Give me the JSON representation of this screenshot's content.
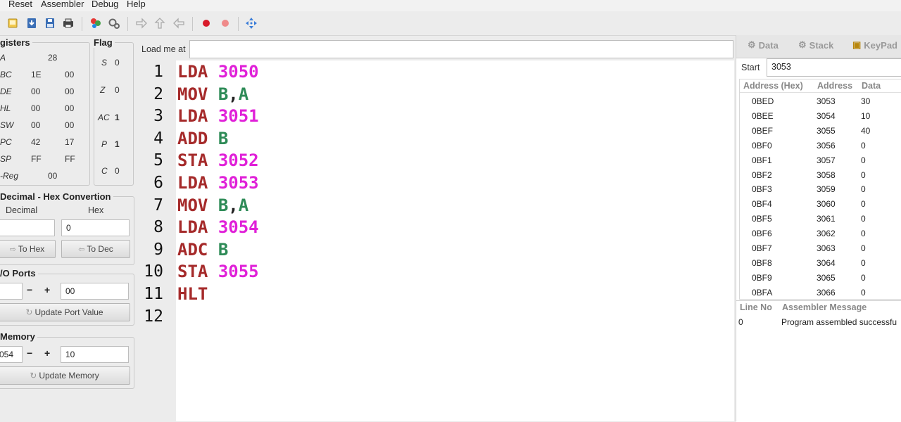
{
  "menu": [
    "Reset",
    "Assembler",
    "Debug",
    "Help"
  ],
  "registers": {
    "title": "gisters",
    "rows": [
      {
        "name": "A",
        "v1": "28",
        "v2": ""
      },
      {
        "name": "BC",
        "v1": "1E",
        "v2": "00"
      },
      {
        "name": "DE",
        "v1": "00",
        "v2": "00"
      },
      {
        "name": "HL",
        "v1": "00",
        "v2": "00"
      },
      {
        "name": "SW",
        "v1": "00",
        "v2": "00"
      },
      {
        "name": "PC",
        "v1": "42",
        "v2": "17"
      },
      {
        "name": "SP",
        "v1": "FF",
        "v2": "FF"
      },
      {
        "name": "-Reg",
        "v1": "00",
        "v2": ""
      }
    ]
  },
  "flags": {
    "title": "Flag",
    "items": [
      {
        "name": "S",
        "value": "0"
      },
      {
        "name": "Z",
        "value": "0"
      },
      {
        "name": "AC",
        "value": "1"
      },
      {
        "name": "P",
        "value": "1"
      },
      {
        "name": "C",
        "value": "0"
      }
    ]
  },
  "conversion": {
    "title": "Decimal - Hex Convertion",
    "decimal_label": "Decimal",
    "hex_label": "Hex",
    "decimal_value": "",
    "hex_value": "0",
    "to_hex": "To Hex",
    "to_dec": "To Dec"
  },
  "io_ports": {
    "title": "/O Ports",
    "port": "",
    "minus": "−",
    "plus": "+",
    "value": "00",
    "update_label": "Update Port Value"
  },
  "memory": {
    "title": "Memory",
    "address": "054",
    "minus": "−",
    "plus": "+",
    "value": "10",
    "update_label": "Update Memory"
  },
  "editor": {
    "load_label": "Load me at",
    "load_value": "",
    "lines": [
      {
        "no": "1",
        "op": "LDA",
        "arg1": "3050",
        "sep": "",
        "arg2": "",
        "argtype": "num"
      },
      {
        "no": "2",
        "op": "MOV",
        "arg1": "B",
        "sep": ",",
        "arg2": "A",
        "argtype": "reg"
      },
      {
        "no": "3",
        "op": "LDA",
        "arg1": "3051",
        "sep": "",
        "arg2": "",
        "argtype": "num"
      },
      {
        "no": "4",
        "op": "ADD",
        "arg1": "B",
        "sep": "",
        "arg2": "",
        "argtype": "reg"
      },
      {
        "no": "5",
        "op": "STA",
        "arg1": "3052",
        "sep": "",
        "arg2": "",
        "argtype": "num"
      },
      {
        "no": "6",
        "op": "LDA",
        "arg1": "3053",
        "sep": "",
        "arg2": "",
        "argtype": "num"
      },
      {
        "no": "7",
        "op": "MOV",
        "arg1": "B",
        "sep": ",",
        "arg2": "A",
        "argtype": "reg"
      },
      {
        "no": "8",
        "op": "LDA",
        "arg1": "3054",
        "sep": "",
        "arg2": "",
        "argtype": "num"
      },
      {
        "no": "9",
        "op": "ADC",
        "arg1": "B",
        "sep": "",
        "arg2": "",
        "argtype": "reg"
      },
      {
        "no": "10",
        "op": "STA",
        "arg1": "3055",
        "sep": "",
        "arg2": "",
        "argtype": "num"
      },
      {
        "no": "11",
        "op": "HLT",
        "arg1": "",
        "sep": "",
        "arg2": "",
        "argtype": "num"
      },
      {
        "no": "12",
        "op": "",
        "arg1": "",
        "sep": "",
        "arg2": "",
        "argtype": "num"
      }
    ]
  },
  "right": {
    "tabs": [
      "Data",
      "Stack",
      "KeyPad"
    ],
    "start_label": "Start",
    "start_value": "3053",
    "table_headers": [
      "Address (Hex)",
      "Address",
      "Data"
    ],
    "rows": [
      {
        "hex": "0BED",
        "addr": "3053",
        "data": "30"
      },
      {
        "hex": "0BEE",
        "addr": "3054",
        "data": "10"
      },
      {
        "hex": "0BEF",
        "addr": "3055",
        "data": "40"
      },
      {
        "hex": "0BF0",
        "addr": "3056",
        "data": "0"
      },
      {
        "hex": "0BF1",
        "addr": "3057",
        "data": "0"
      },
      {
        "hex": "0BF2",
        "addr": "3058",
        "data": "0"
      },
      {
        "hex": "0BF3",
        "addr": "3059",
        "data": "0"
      },
      {
        "hex": "0BF4",
        "addr": "3060",
        "data": "0"
      },
      {
        "hex": "0BF5",
        "addr": "3061",
        "data": "0"
      },
      {
        "hex": "0BF6",
        "addr": "3062",
        "data": "0"
      },
      {
        "hex": "0BF7",
        "addr": "3063",
        "data": "0"
      },
      {
        "hex": "0BF8",
        "addr": "3064",
        "data": "0"
      },
      {
        "hex": "0BF9",
        "addr": "3065",
        "data": "0"
      },
      {
        "hex": "0BFA",
        "addr": "3066",
        "data": "0"
      }
    ],
    "msg_headers": [
      "Line No",
      "Assembler Message"
    ],
    "messages": [
      {
        "line": "0",
        "text": "Program assembled successfu"
      }
    ]
  }
}
